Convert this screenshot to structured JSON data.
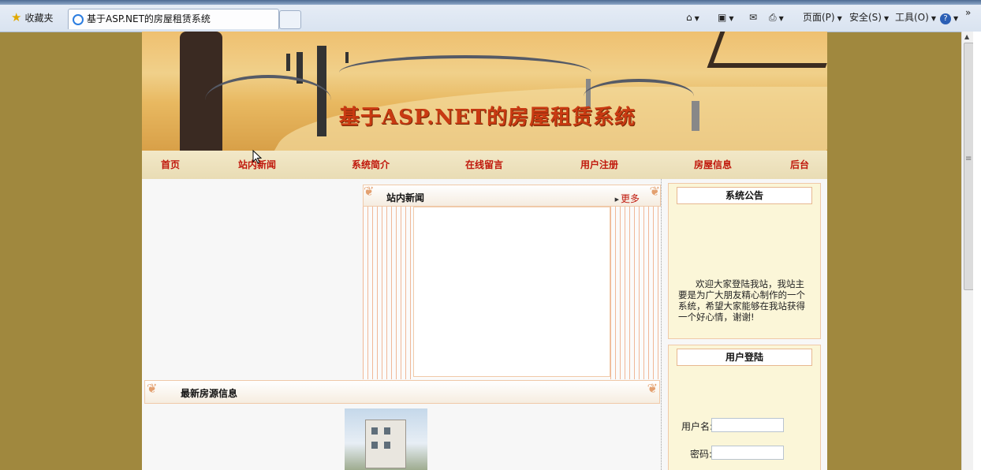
{
  "browser": {
    "favorites_label": "收藏夹",
    "tab_title": "基于ASP.NET的房屋租赁系统",
    "commands": {
      "page": "页面(P)",
      "safety": "安全(S)",
      "tools": "工具(O)",
      "help": "?"
    },
    "overflow": "»"
  },
  "site": {
    "banner_title": "基于ASP.NET的房屋租赁系统",
    "nav": [
      "首页",
      "站内新闻",
      "系统简介",
      "在线留言",
      "用户注册",
      "房屋信息",
      "后台"
    ],
    "news": {
      "title": "站内新闻",
      "more": "更多"
    },
    "latest_title": "最新房源信息",
    "announcement": {
      "title": "系统公告",
      "body": "欢迎大家登陆我站，我站主要是为广大朋友精心制作的一个系统，希望大家能够在我站获得一个好心情，谢谢!"
    },
    "login": {
      "title": "用户登陆",
      "username_label": "用户名:",
      "password_label": "密码:",
      "username_value": "",
      "password_value": ""
    }
  },
  "colors": {
    "outer_bg": "#a0883e",
    "nav_text": "#c0180c",
    "title_text": "#c93a12"
  }
}
